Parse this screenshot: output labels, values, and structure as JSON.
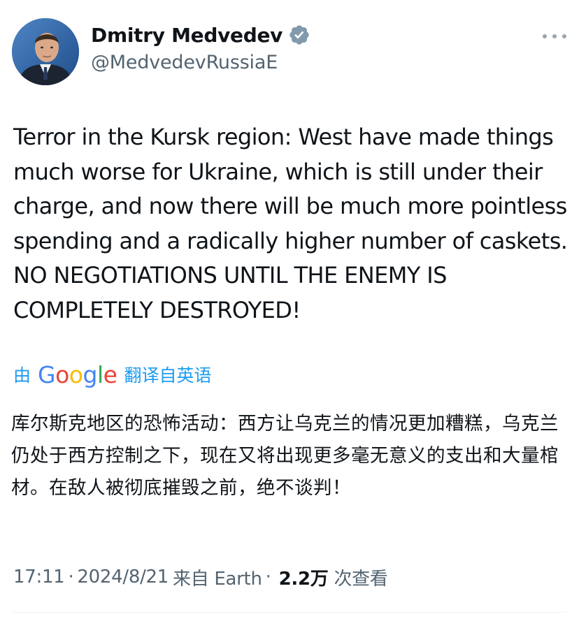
{
  "author": {
    "display_name": "Dmitry Medvedev",
    "handle": "@MedvedevRussiaE",
    "verified_icon": "verified-badge-icon",
    "avatar_icon": "avatar-photo"
  },
  "menu": {
    "icon": "more-horizontal-icon"
  },
  "tweet": {
    "text": "Terror in the Kursk region: West have made things much worse for Ukraine, which is still under their charge, and now there will be much more pointless spending and a radically higher number of caskets. NO NEGOTIATIONS UNTIL THE ENEMY IS COMPLETELY DESTROYED!"
  },
  "translation": {
    "prefix": "由",
    "logo_letters": [
      "G",
      "o",
      "o",
      "g",
      "l",
      "e"
    ],
    "logo_colors": [
      "#4285F4",
      "#EA4335",
      "#FBBC05",
      "#4285F4",
      "#34A853",
      "#EA4335"
    ],
    "suffix": "翻译自英语",
    "text": "库尔斯克地区的恐怖活动：西方让乌克兰的情况更加糟糕，乌克兰仍处于西方控制之下，现在又将出现更多毫无意义的支出和大量棺材。在敌人被彻底摧毁之前，绝不谈判！"
  },
  "meta": {
    "time": "17:11",
    "date": "2024/8/21",
    "source": "来自 Earth",
    "separator": "·",
    "views_count": "2.2万",
    "views_label": "次查看"
  },
  "colors": {
    "link": "#1d9bf0",
    "secondary_text": "#536471",
    "primary_text": "#0f1419",
    "verified": "#829aab"
  }
}
